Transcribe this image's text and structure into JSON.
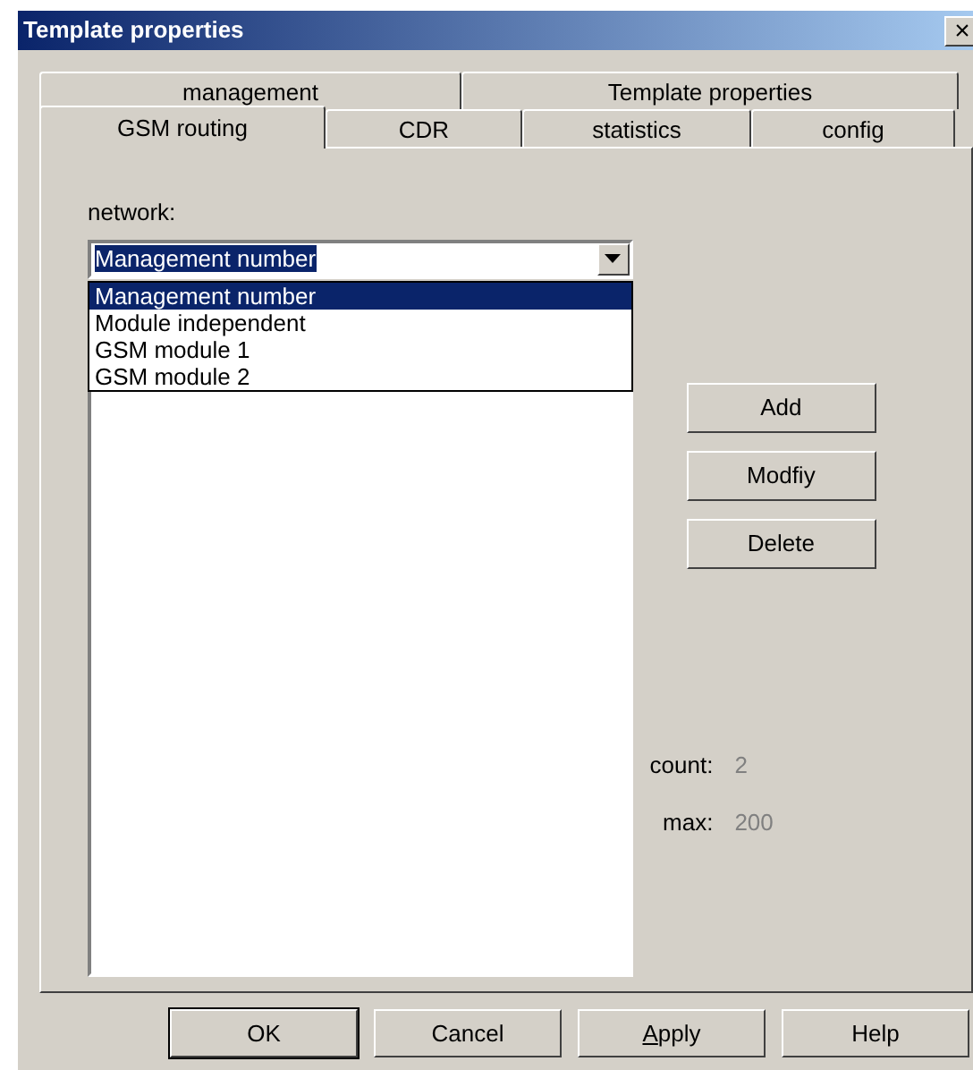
{
  "window": {
    "title": "Template properties",
    "close": "×"
  },
  "tab_rows": [
    [
      {
        "label": "management",
        "selected": false
      },
      {
        "label": "Template properties",
        "selected": false
      }
    ],
    [
      {
        "label": "GSM routing",
        "selected": true
      },
      {
        "label": "CDR",
        "selected": false
      },
      {
        "label": "statistics",
        "selected": false
      },
      {
        "label": "config",
        "selected": false
      }
    ]
  ],
  "network": {
    "label": "network:",
    "value": "Management number",
    "expanded": true,
    "options": [
      {
        "label": "Management number",
        "selected": true
      },
      {
        "label": "Module independent",
        "selected": false
      },
      {
        "label": "GSM module 1",
        "selected": false
      },
      {
        "label": "GSM module 2",
        "selected": false
      }
    ]
  },
  "side_buttons": [
    "Add",
    "Modfiy",
    "Delete"
  ],
  "stats": [
    {
      "label": "count:",
      "value": "2"
    },
    {
      "label": "max:",
      "value": "200"
    }
  ],
  "buttons": [
    {
      "label": "OK",
      "default": true,
      "underline_first": false
    },
    {
      "label": "Cancel",
      "default": false,
      "underline_first": false
    },
    {
      "label": "Apply",
      "default": false,
      "underline_first": true
    },
    {
      "label": "Help",
      "default": false,
      "underline_first": false
    }
  ]
}
